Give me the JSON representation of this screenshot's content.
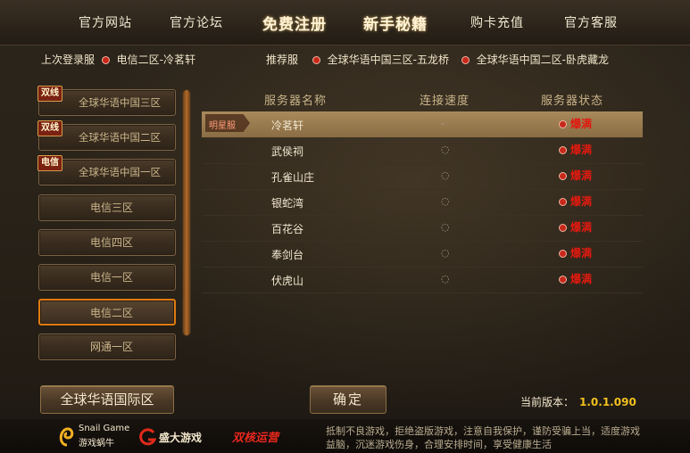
{
  "nav": {
    "items": [
      "官方网站",
      "官方论坛",
      "免费注册",
      "新手秘籍",
      "购卡充值",
      "官方客服"
    ]
  },
  "last_login": {
    "label": "上次登录服",
    "server": "电信二区-冷茗轩"
  },
  "recommend": {
    "label": "推荐服",
    "servers": [
      "全球华语中国三区-五龙桥",
      "全球华语中国二区-卧虎藏龙"
    ]
  },
  "server_groups": [
    {
      "label": "全球华语中国三区",
      "tag": "双线"
    },
    {
      "label": "全球华语中国二区",
      "tag": "双线"
    },
    {
      "label": "全球华语中国一区",
      "tag": "电信"
    },
    {
      "label": "电信三区",
      "tag": ""
    },
    {
      "label": "电信四区",
      "tag": ""
    },
    {
      "label": "电信一区",
      "tag": ""
    },
    {
      "label": "电信二区",
      "tag": ""
    },
    {
      "label": "网通一区",
      "tag": ""
    }
  ],
  "selected_group": "电信二区",
  "table": {
    "headers": {
      "name": "服务器名称",
      "speed": "连接速度",
      "status": "服务器状态"
    },
    "rows": [
      {
        "badge": "明星服",
        "name": "冷茗轩",
        "speed": "-",
        "status": "爆满"
      },
      {
        "badge": "",
        "name": "武侯祠",
        "speed": "",
        "status": "爆满"
      },
      {
        "badge": "",
        "name": "孔雀山庄",
        "speed": "",
        "status": "爆满"
      },
      {
        "badge": "",
        "name": "银蛇湾",
        "speed": "",
        "status": "爆满"
      },
      {
        "badge": "",
        "name": "百花谷",
        "speed": "",
        "status": "爆满"
      },
      {
        "badge": "",
        "name": "奉剑台",
        "speed": "",
        "status": "爆满"
      },
      {
        "badge": "",
        "name": "伏虎山",
        "speed": "",
        "status": "爆满"
      }
    ]
  },
  "buttons": {
    "intl": "全球华语国际区",
    "confirm": "确定"
  },
  "version": {
    "label": "当前版本：",
    "value": "1.0.1.090"
  },
  "footer": {
    "snail": "Snail Game",
    "snail_cn": "游戏蜗牛",
    "shanda": "盛大游戏",
    "dual": "双核运营",
    "notice": "抵制不良游戏，拒绝盗版游戏，注意自我保护，谨防受骗上当，适度游戏益脑，沉迷游戏伤身，合理安排时间，享受健康生活"
  },
  "colors": {
    "accent": "#e07a12",
    "status_red": "#e01a10",
    "version_gold": "#f0c020"
  }
}
